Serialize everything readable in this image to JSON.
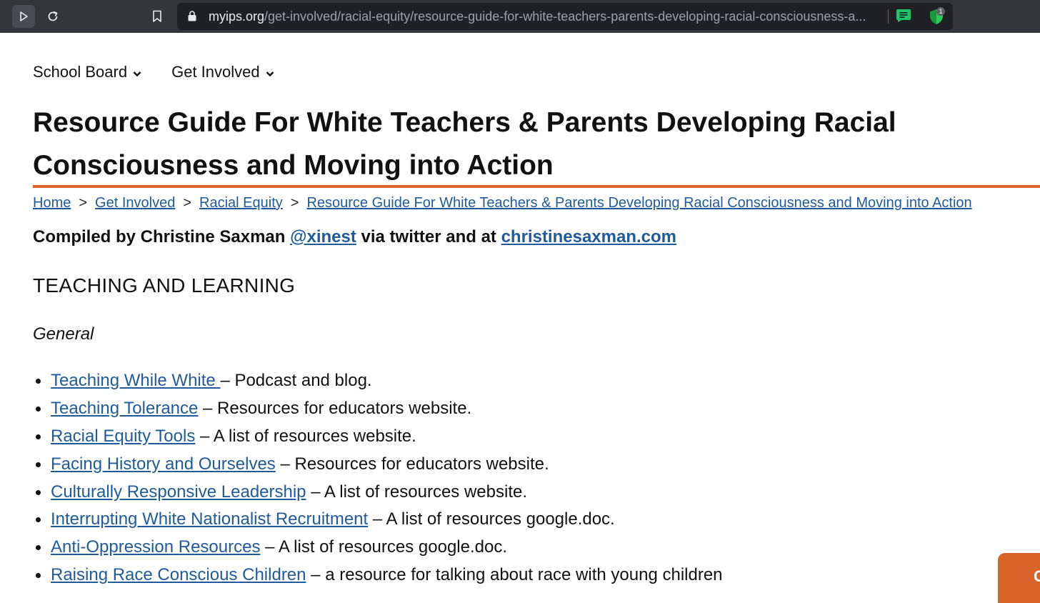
{
  "browser": {
    "url_host": "myips.org",
    "url_path": "/get-involved/racial-equity/resource-guide-for-white-teachers-parents-developing-racial-consciousness-a...",
    "extension_badge": "1"
  },
  "nav": {
    "items": [
      {
        "label": "School Board"
      },
      {
        "label": "Get Involved"
      }
    ]
  },
  "page": {
    "title": "Resource Guide For White Teachers & Parents Developing Racial Consciousness and Moving into Action",
    "breadcrumb": [
      "Home",
      "Get Involved",
      "Racial Equity",
      "Resource Guide For White Teachers & Parents Developing Racial Consciousness and Moving into Action"
    ],
    "breadcrumb_separator": ">",
    "credit": {
      "prefix": "Compiled by Christine Saxman ",
      "handle": "@xinest",
      "middle": " via twitter and at ",
      "site": "christinesaxman.com"
    },
    "section_title": "TEACHING AND LEARNING",
    "subhead": "General",
    "resources": [
      {
        "link": "Teaching While White ",
        "desc": "– Podcast and blog."
      },
      {
        "link": "Teaching Tolerance",
        "desc": " – Resources for educators website."
      },
      {
        "link": "Racial Equity Tools",
        "desc": " – A list of resources website."
      },
      {
        "link": "Facing History and Ourselves",
        "desc": " – Resources for educators website."
      },
      {
        "link": "Culturally Responsive Leadership",
        "desc": " – A list of resources website."
      },
      {
        "link": "Interrupting White Nationalist Recruitment",
        "desc": " – A list of resources google.doc."
      },
      {
        "link": "Anti-Oppression Resources",
        "desc": " – A list of resources google.doc."
      },
      {
        "link": "Raising Race Conscious Children",
        "desc": " – a resource for talking about race with young children"
      }
    ],
    "cta_label": "C"
  },
  "colors": {
    "accent": "#d9642a",
    "link": "#1f5b9c",
    "chrome": "#35363a"
  }
}
